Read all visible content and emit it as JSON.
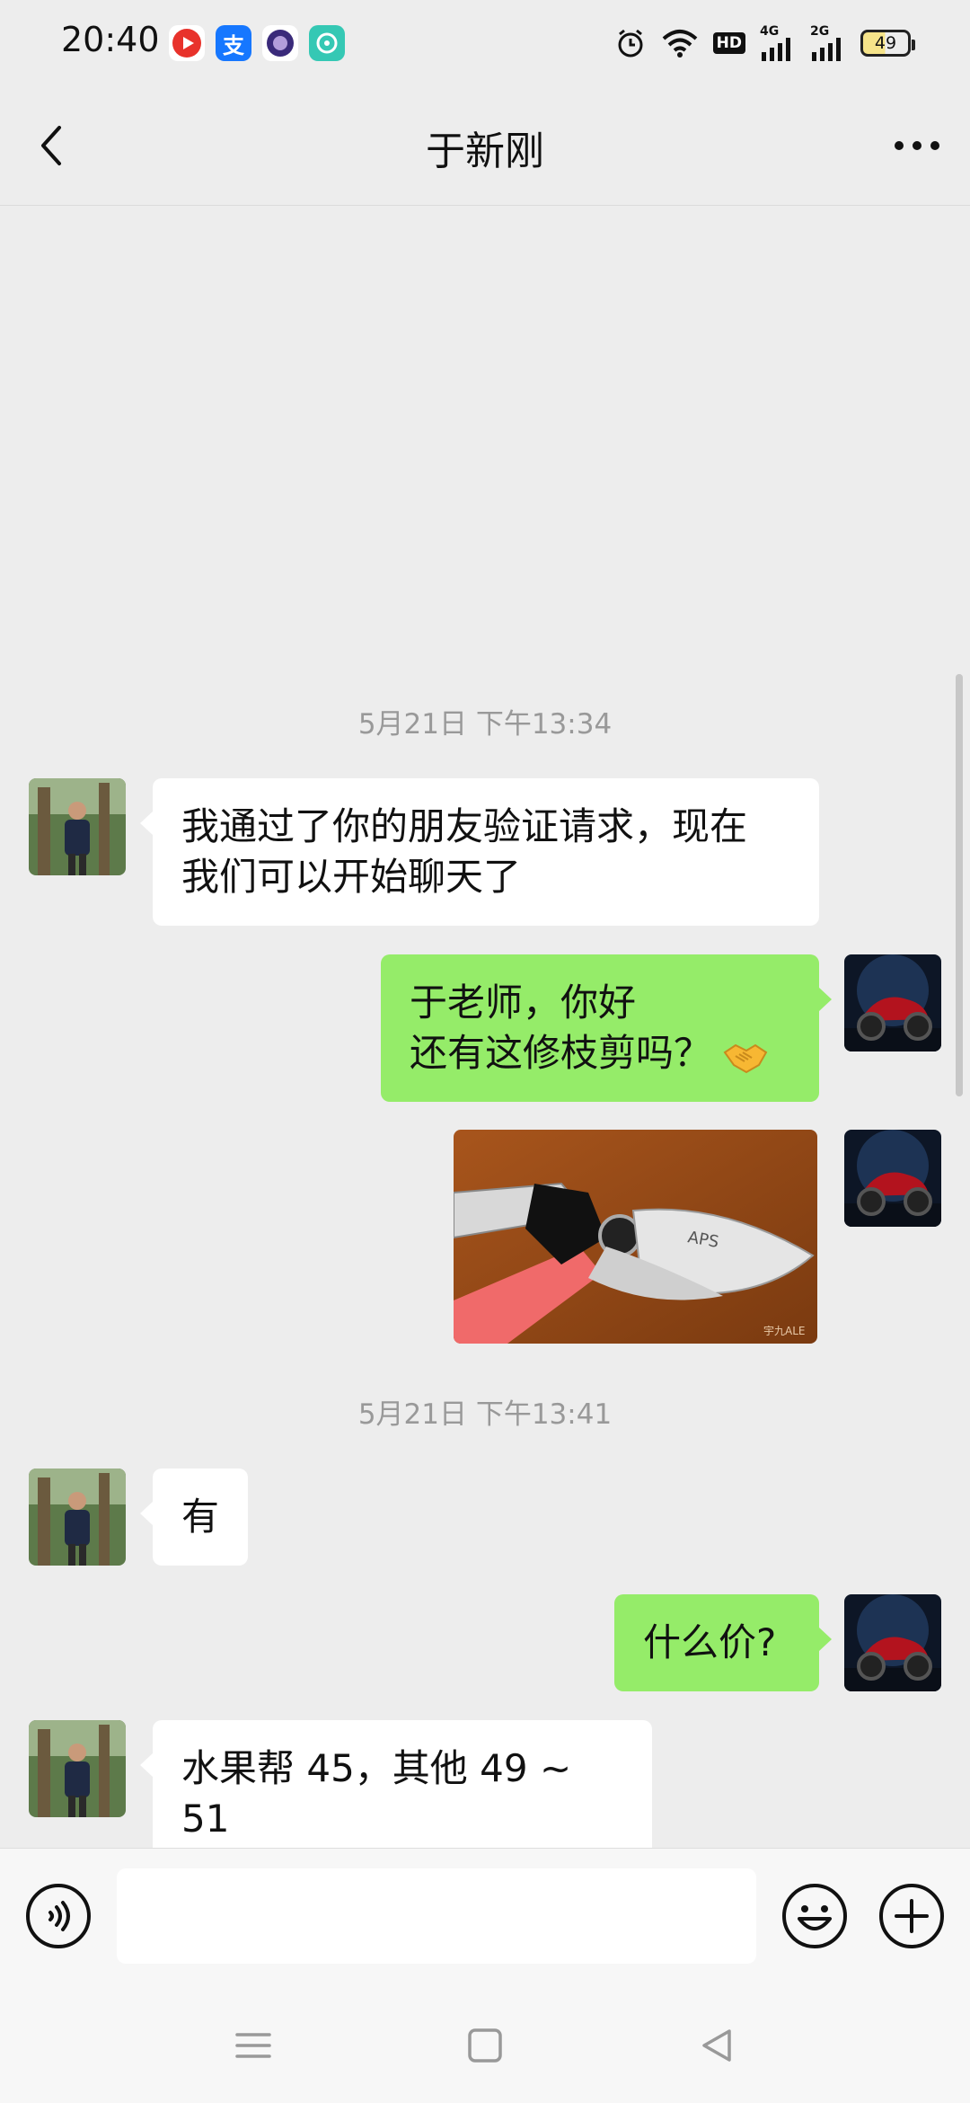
{
  "status_bar": {
    "time": "20:40",
    "battery": "49",
    "hd": "HD",
    "net1": "4G",
    "net2": "2G",
    "app_icons": [
      "video-app-icon",
      "alipay-icon",
      "purple-app-icon",
      "teal-app-icon"
    ],
    "alipay_char": "支"
  },
  "nav": {
    "title": "于新刚"
  },
  "messages": [
    {
      "type": "timestamp",
      "text": "5月21日 下午13:34"
    },
    {
      "type": "text",
      "side": "left",
      "lines": [
        "我通过了你的朋友验证请求，现在",
        "我们可以开始聊天了"
      ]
    },
    {
      "type": "text",
      "side": "right",
      "lines": [
        "于老师，你好",
        "还有这修枝剪吗？"
      ],
      "emoji": "handshake-icon"
    },
    {
      "type": "image",
      "side": "right",
      "image_text": [
        "APS",
        "宇九ALE"
      ]
    },
    {
      "type": "timestamp",
      "text": "5月21日 下午13:41"
    },
    {
      "type": "text",
      "side": "left",
      "lines": [
        "有"
      ]
    },
    {
      "type": "text",
      "side": "right",
      "lines": [
        "什么价?"
      ]
    },
    {
      "type": "text",
      "side": "left",
      "lines": [
        "水果帮 45，其他 49 ~ 51"
      ]
    }
  ],
  "input": {
    "value": "",
    "placeholder": ""
  },
  "colors": {
    "background": "#ededed",
    "sent_bubble": "#95ec69",
    "received_bubble": "#ffffff",
    "timestamp": "#999999"
  }
}
